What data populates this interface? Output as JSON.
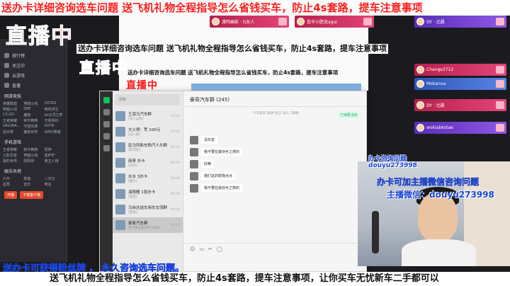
{
  "banner": {
    "top_line": "送办卡详细咨询选车问题   送飞机礼物全程指导怎么省钱买车，防止4s套路，提车注意事项",
    "mid_line": "送办卡详细咨询选车问题   送飞机礼物全程指导怎么省钱买车，防止4s套路，提车注意事项",
    "small_line": "送办卡详细咨询选车问题   送飞机礼物全程指导怎么省钱买车，防止4s套路，提车注意事项"
  },
  "live_label": "直播中",
  "gifts": [
    {
      "name": "渡鸣幽影 · G女人"
    },
    {
      "name": "追辛小肥龙agui"
    },
    {
      "name": "DY · 北晨"
    },
    {
      "name": "Change3712"
    },
    {
      "name": "Mokanua"
    },
    {
      "name": "DY · 北晨"
    },
    {
      "name": "wokiabkotae"
    }
  ],
  "sidebar": {
    "items": [
      "排行榜",
      "关注中",
      "云游戏",
      "直播"
    ],
    "section_hot": "网游竞技",
    "hot_games": [
      "英雄联盟",
      "穿越火线",
      "DOTA2",
      "穿越火线",
      "DNF",
      "绝地求生",
      "CS:GO",
      "魔兽",
      "lol云顶之弈",
      "王者荣耀",
      "和平精英",
      "无畏契约",
      "VALORA...",
      "守望先锋",
      "DOTA",
      "逆水寒",
      "魔兽世界",
      "APEX英雄"
    ],
    "section_mobile": "手机游戏",
    "mobile_games": [
      "王者荣耀",
      "和平精英",
      "原神",
      "火影忍者",
      "穿越火线",
      "金铲铲",
      "我的世界",
      "阴阳师",
      "第五人格"
    ],
    "section_more": "娱乐天地",
    "more_games": [
      "户外",
      "颜值",
      "二次元",
      "星秀",
      "音乐",
      "电台"
    ],
    "btn_open": "开播",
    "btn_download": "下载客户端"
  },
  "wechat": {
    "search_placeholder": "搜索",
    "chats": [
      {
        "title": "王润马汽车群",
        "preview": "[有人@我]",
        "time": "10:23"
      },
      {
        "title": "大火哥：荒 100元",
        "preview": "[已入账]",
        "time": "10:20"
      },
      {
        "title": "驻马所新车购汽人头群",
        "preview": "[新消息]",
        "time": "10:10"
      },
      {
        "title": "庞哥 办卡",
        "preview": "[好的]",
        "time": "09:50"
      },
      {
        "title": "水水 3办卡",
        "preview": "[图片]",
        "time": "09:40"
      },
      {
        "title": "溪翔瞳 1张办卡",
        "preview": "[语音]",
        "time": "09:30"
      },
      {
        "title": "马自达选车用车交流群",
        "preview": "[链接]",
        "time": "09:20"
      },
      {
        "title": "豪奇汽车群",
        "preview": "我不要拉最快手之类的",
        "time": "09:10"
      }
    ],
    "chat_title": "豪奇汽车群 (245)",
    "sys_notice": "\"汽车家长\"邀请\"张三\"加入了群聊",
    "messages": [
      {
        "name": "",
        "text": "没抖音"
      },
      {
        "name": "",
        "text": "我不要拉最快手之类的"
      },
      {
        "name": "",
        "text": "好嘛"
      },
      {
        "name": "",
        "text": "我们这的帮我点点"
      },
      {
        "name": "",
        "text": "我不要拉最快手之类的"
      }
    ],
    "notice_green": "已读群消息"
  },
  "cam_overlay": {
    "line1": "办卡可加主播微信咨询问题",
    "line2": "主播微信：douyu273998",
    "small_line1": "办卡咨询问题",
    "small_line2": "douyu273998"
  },
  "bottom": {
    "fans": "送办卡可获得粉丝牌 ， 永久咨询选车问题。",
    "ticker": "送飞机礼物全程指导怎么省钱买车，防止4s套路，提车注意事项，让你买车无忧新车二手都可以"
  }
}
